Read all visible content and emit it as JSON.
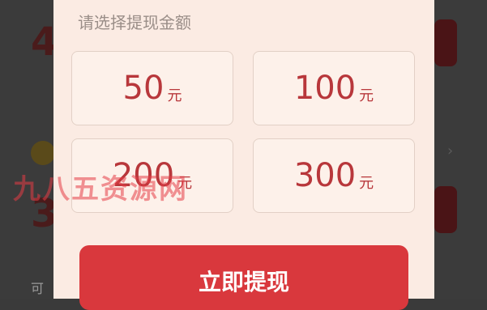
{
  "background": {
    "top_digit": "4",
    "mid_digit": "3",
    "bottom_text": "可",
    "chevron": "›"
  },
  "sheet": {
    "title": "请选择提现金额",
    "options": [
      {
        "amount": "50",
        "unit": "元"
      },
      {
        "amount": "100",
        "unit": "元"
      },
      {
        "amount": "200",
        "unit": "元"
      },
      {
        "amount": "300",
        "unit": "元"
      }
    ],
    "withdraw_label": "立即提现"
  },
  "watermark": "九八五资源网",
  "colors": {
    "accent": "#d9383d",
    "amount_text": "#b8373b",
    "sheet_bg": "#fbebe3"
  }
}
